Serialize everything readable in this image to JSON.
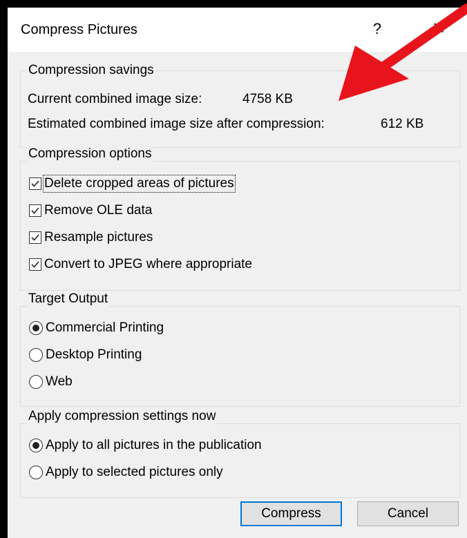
{
  "window": {
    "title": "Compress Pictures",
    "help_label": "?",
    "close_label": "✕"
  },
  "savings": {
    "title": "Compression savings",
    "current_label": "Current combined image size:",
    "current_value": "4758 KB",
    "estimated_label": "Estimated combined image size after compression:",
    "estimated_value": "612 KB"
  },
  "options": {
    "title": "Compression options",
    "items": [
      {
        "label": "Delete cropped areas of pictures",
        "checked": true
      },
      {
        "label": "Remove OLE data",
        "checked": true
      },
      {
        "label": "Resample pictures",
        "checked": true
      },
      {
        "label": "Convert to JPEG where appropriate",
        "checked": true
      }
    ]
  },
  "target": {
    "title": "Target Output",
    "items": [
      {
        "label": "Commercial Printing",
        "selected": true
      },
      {
        "label": "Desktop Printing",
        "selected": false
      },
      {
        "label": "Web",
        "selected": false
      }
    ]
  },
  "apply": {
    "title": "Apply compression settings now",
    "items": [
      {
        "label": "Apply to all pictures in the publication",
        "selected": true
      },
      {
        "label": "Apply to selected pictures only",
        "selected": false
      }
    ]
  },
  "buttons": {
    "compress_label": "Compress",
    "cancel_label": "Cancel"
  },
  "colors": {
    "arrow": "#e8141b",
    "default_button_border": "#0078d7"
  }
}
